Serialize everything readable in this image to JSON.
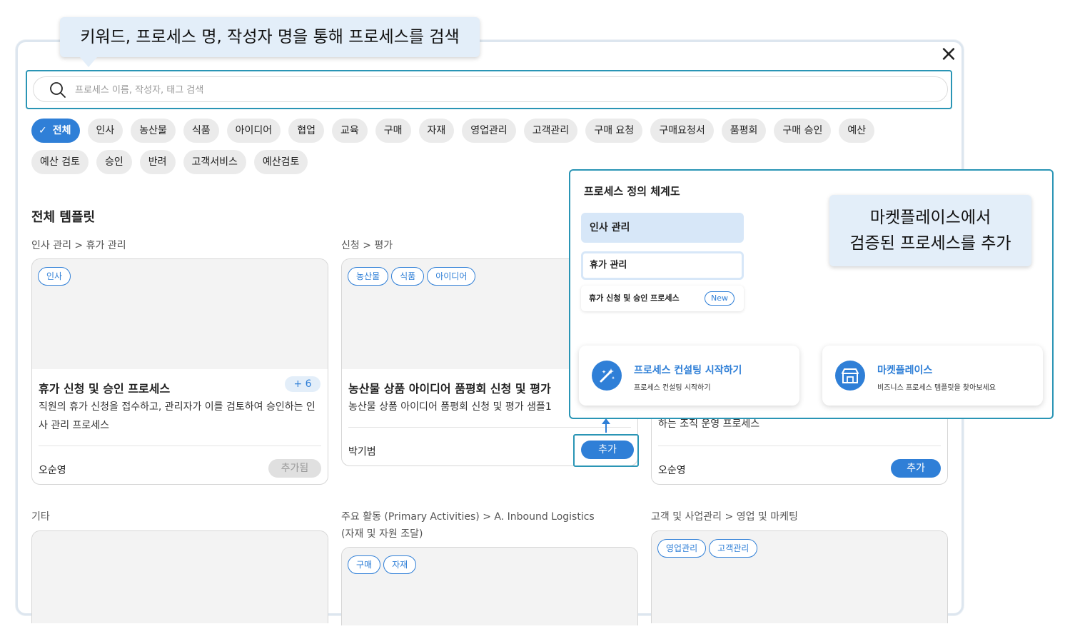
{
  "tooltips": {
    "search_hint": "키워드, 프로세스 명, 작성자 명을 통해 프로세스를 검색",
    "marketplace_hint_line1": "마켓플레이스에서",
    "marketplace_hint_line2": "검증된 프로세스를 추가"
  },
  "close_icon": "×",
  "search": {
    "placeholder": "프로세스 이름, 작성자, 태그 검색",
    "value": ""
  },
  "categories": {
    "all_label": "전체",
    "items": [
      "인사",
      "농산물",
      "식품",
      "아이디어",
      "협업",
      "교육",
      "구매",
      "자재",
      "영업관리",
      "고객관리",
      "구매 요청",
      "구매요청서",
      "품평회",
      "구매 승인",
      "예산",
      "예산 검토",
      "승인",
      "반려",
      "고객서비스",
      "예산검토"
    ]
  },
  "section_title": "전체 템플릿",
  "templates": [
    {
      "path": "인사 관리 > 휴가 관리",
      "tags": [
        "인사"
      ],
      "title": "휴가 신청 및 승인 프로세스",
      "extra_tags": "+ 6",
      "description": "직원의 휴가 신청을 접수하고, 관리자가 이를 검토하여 승인하는 인사 관리 프로세스",
      "author": "오순영",
      "button": "추가됨"
    },
    {
      "path": "신청 > 평가",
      "tags": [
        "농산물",
        "식품",
        "아이디어"
      ],
      "title": "농산물 상품 아이디어 품평회 신청 및 평가",
      "description": "농산물 상품 아이디어 품평회 신청 및 평가 샘플1",
      "author": "박기범",
      "button": "추가"
    },
    {
      "description_tail": "하는 조직 운영 프로세스",
      "author": "오순영",
      "button": "추가"
    },
    {
      "path": "기타"
    },
    {
      "path_line1": "주요 활동 (Primary Activities) > A. Inbound Logistics",
      "path_line2": "(자재 및 자원 조달)",
      "tags": [
        "구매",
        "자재"
      ]
    },
    {
      "path": "고객 및 사업관리 > 영업 및 마케팅",
      "tags": [
        "영업관리",
        "고객관리"
      ]
    }
  ],
  "panel": {
    "title": "프로세스 정의 체계도",
    "level1": "인사 관리",
    "level2": "휴가 관리",
    "level3": "휴가 신청 및 승인 프로세스",
    "new_badge": "New",
    "consulting": {
      "title": "프로세스 컨설팅 시작하기",
      "subtitle": "프로세스 컨설팅 시작하기",
      "icon": "magic-wand-icon"
    },
    "marketplace": {
      "title": "마켓플레이스",
      "subtitle": "비즈니스 프로세스 템플릿을 찾아보세요",
      "icon": "storefront-icon"
    }
  },
  "colors": {
    "accent": "#2f7fd7",
    "highlight_frame": "#2a95b5",
    "tooltip_bg": "#e3eef9"
  }
}
